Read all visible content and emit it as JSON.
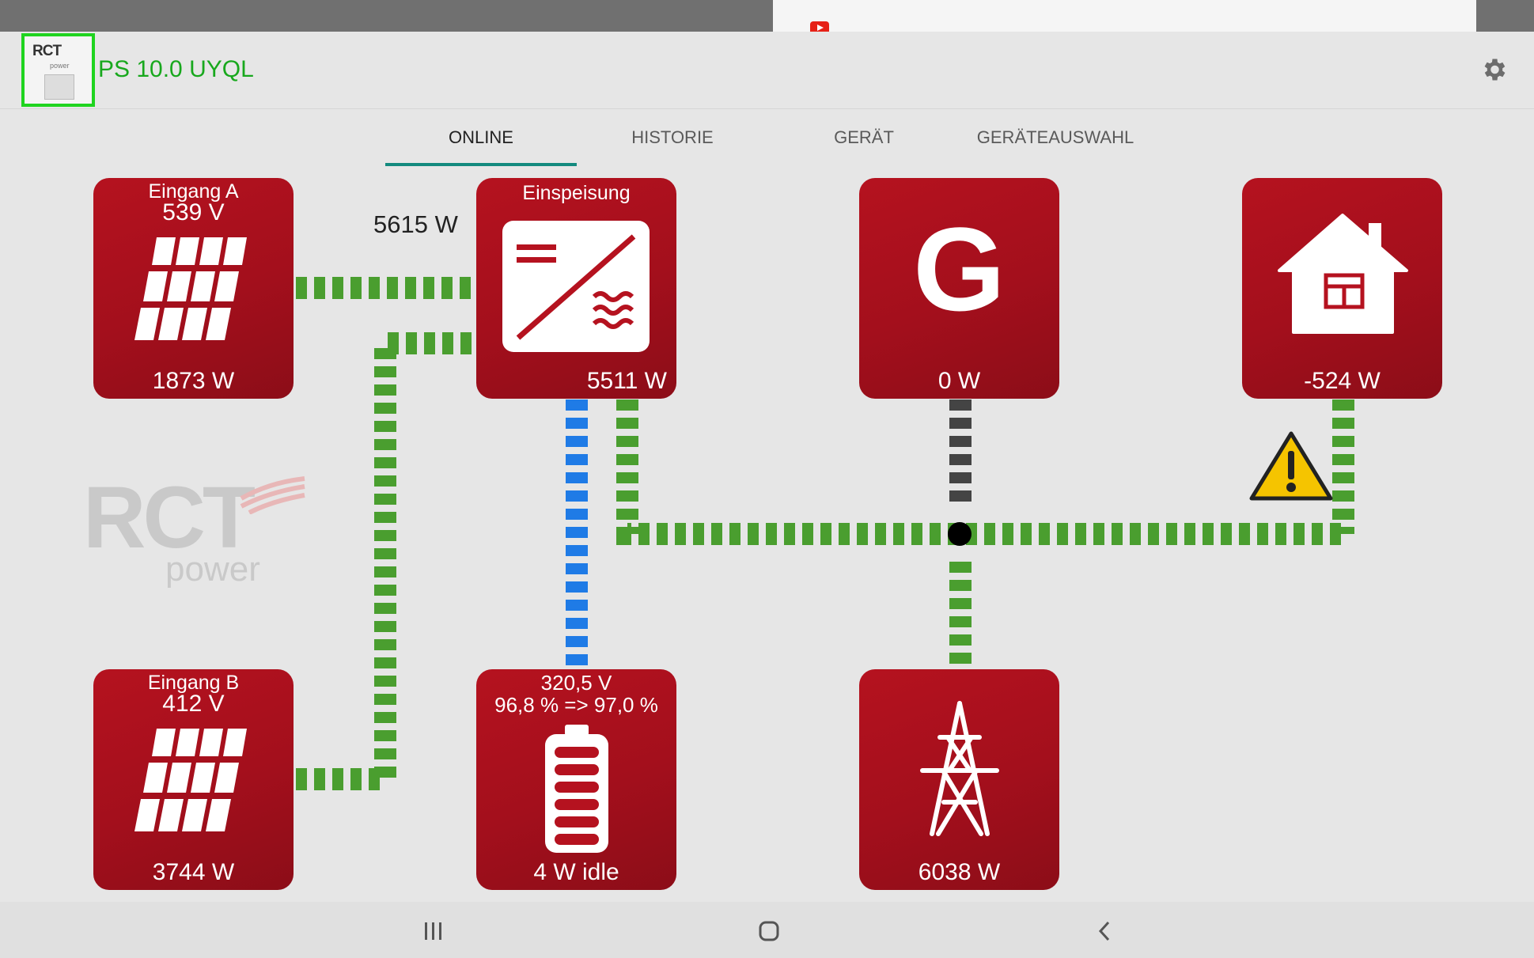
{
  "device": {
    "title": "PS 10.0 UYQL",
    "thumb_logo": "RCT",
    "thumb_sub": "power"
  },
  "tabs": [
    {
      "label": "ONLINE",
      "active": true
    },
    {
      "label": "HISTORIE",
      "active": false
    },
    {
      "label": "GERÄT",
      "active": false
    },
    {
      "label": "GERÄTEAUSWAHL",
      "active": false
    }
  ],
  "tiles": {
    "input_a": {
      "title": "Eingang A",
      "voltage": "539 V",
      "power": "1873 W",
      "icon": "solar-panel-icon"
    },
    "inverter": {
      "title": "Einspeisung",
      "power": "5511 W",
      "icon": "inverter-icon"
    },
    "generator": {
      "letter": "G",
      "power": "0 W",
      "icon": "generator-icon"
    },
    "house": {
      "power": "-524 W",
      "icon": "house-icon"
    },
    "input_b": {
      "title": "Eingang B",
      "voltage": "412 V",
      "power": "3744 W",
      "icon": "solar-panel-icon"
    },
    "battery": {
      "voltage": "320,5 V",
      "soc": "96,8 % => 97,0 %",
      "status": "4 W idle",
      "icon": "battery-icon"
    },
    "grid": {
      "power": "6038 W",
      "icon": "power-pylon-icon"
    }
  },
  "flow": {
    "pv_total": "5615 W"
  },
  "watermark": {
    "brand": "RCT",
    "sub": "power"
  },
  "colors": {
    "tile": "#a30f1c",
    "flow_active": "#4a9e2f",
    "flow_battery": "#1f7be6",
    "flow_inactive": "#444444",
    "title_green": "#18a81d",
    "tab_indicator": "#138a7e"
  },
  "icons": {
    "settings": "gear-icon",
    "warning": "warning-icon",
    "notification": "youtube-icon",
    "nav_recent": "recent-apps-icon",
    "nav_home": "home-icon",
    "nav_back": "back-icon"
  }
}
